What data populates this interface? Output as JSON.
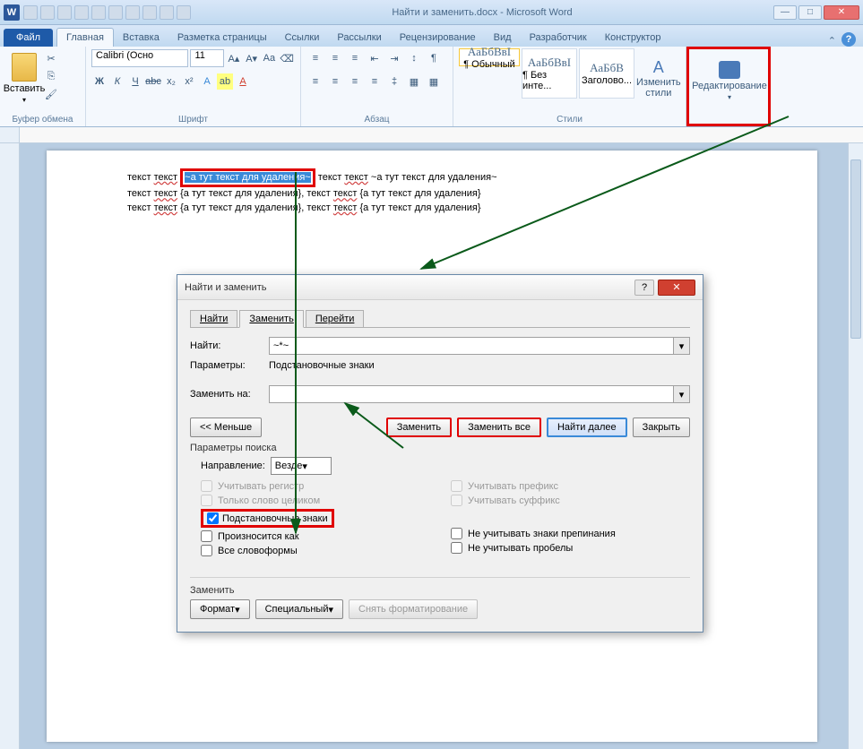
{
  "title": "Найти и заменить.docx - Microsoft Word",
  "tabs": {
    "file": "Файл",
    "home": "Главная",
    "insert": "Вставка",
    "layout": "Разметка страницы",
    "refs": "Ссылки",
    "mail": "Рассылки",
    "review": "Рецензирование",
    "view": "Вид",
    "dev": "Разработчик",
    "design": "Конструктор"
  },
  "ribbon": {
    "paste": "Вставить",
    "clipboard": "Буфер обмена",
    "font": "Шрифт",
    "paragraph": "Абзац",
    "styles_lbl": "Стили",
    "editing": "Редактирование",
    "change_styles": "Изменить стили",
    "font_name": "Calibri (Осно",
    "font_size": "11",
    "styles": [
      {
        "prev": "АаБбВвІ",
        "name": "¶ Обычный"
      },
      {
        "prev": "АаБбВвІ",
        "name": "¶ Без инте..."
      },
      {
        "prev": "АаБбВ",
        "name": "Заголово..."
      }
    ]
  },
  "doc": {
    "line1_a": "текст ",
    "line1_b": "текст",
    "line1_hl": "~а тут текст для удаления~",
    "line1_c": " текст ",
    "line1_d": "текст",
    "line1_e": " ~а тут текст для удаления~",
    "line2": "текст ",
    "line2b": "текст",
    "line2c": " {а тут текст для удаления}, текст ",
    "line2d": "текст",
    "line2e": " {а тут текст для удаления}",
    "line3": "текст ",
    "line3b": "текст",
    "line3c": " {а тут текст для удаления}, текст ",
    "line3d": "текст",
    "line3e": " {а тут текст для удаления}"
  },
  "dialog": {
    "title": "Найти и заменить",
    "tabs": {
      "find": "Найти",
      "replace": "Заменить",
      "goto": "Перейти"
    },
    "find_lbl": "Найти:",
    "find_val": "~*~",
    "params_lbl": "Параметры:",
    "params_val": "Подстановочные знаки",
    "replace_lbl": "Заменить на:",
    "replace_val": "",
    "less": "<< Меньше",
    "replace_btn": "Заменить",
    "replace_all": "Заменить все",
    "find_next": "Найти далее",
    "close": "Закрыть",
    "search_params": "Параметры поиска",
    "direction": "Направление:",
    "dir_val": "Везде",
    "match_case": "Учитывать регистр",
    "whole_word": "Только слово целиком",
    "wildcards": "Подстановочные знаки",
    "sounds_like": "Произносится как",
    "all_forms": "Все словоформы",
    "prefix": "Учитывать префикс",
    "suffix": "Учитывать суффикс",
    "ignore_punct": "Не учитывать знаки препинания",
    "ignore_space": "Не учитывать пробелы",
    "replace_sec": "Заменить",
    "format": "Формат",
    "special": "Специальный",
    "no_format": "Снять форматирование"
  }
}
